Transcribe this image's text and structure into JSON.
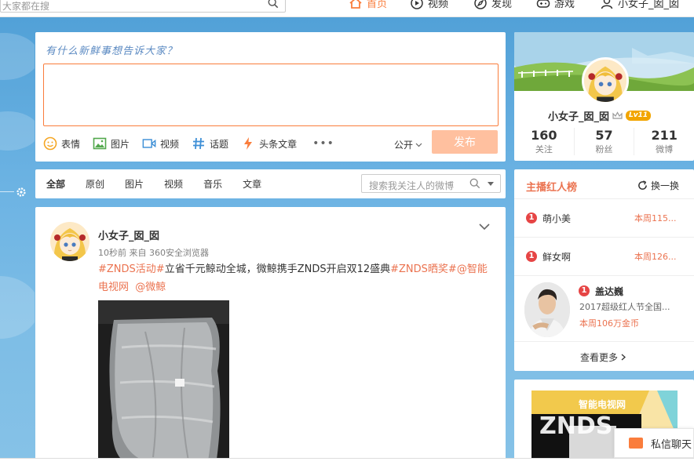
{
  "topbar": {
    "search_placeholder": "大家都在搜",
    "nav": [
      {
        "label": "首页",
        "icon": "home-icon",
        "active": true
      },
      {
        "label": "视频",
        "icon": "video-icon"
      },
      {
        "label": "发现",
        "icon": "discover-icon"
      },
      {
        "label": "游戏",
        "icon": "gamepad-icon"
      },
      {
        "label": "小女子_囡_囡",
        "icon": "user-icon"
      }
    ]
  },
  "publisher": {
    "prompt": "有什么新鲜事想告诉大家？",
    "tools": [
      {
        "label": "表情",
        "icon": "emoji-icon"
      },
      {
        "label": "图片",
        "icon": "image-icon"
      },
      {
        "label": "视频",
        "icon": "video-camera-icon"
      },
      {
        "label": "话题",
        "icon": "hashtag-icon"
      },
      {
        "label": "头条文章",
        "icon": "lightning-icon"
      }
    ],
    "more": "•••",
    "visibility": "公开",
    "publish_label": "发布"
  },
  "feed_tabs": {
    "items": [
      "全部",
      "原创",
      "图片",
      "视频",
      "音乐",
      "文章"
    ],
    "active": "全部",
    "search_placeholder": "搜索我关注人的微博"
  },
  "post": {
    "username": "小女子_囡_囡",
    "meta": "10秒前 来自 360安全浏览器",
    "topic1": "#ZNDS活动#",
    "text1": "立省千元鲸动全城，微鲸携手ZNDS开启双12盛典",
    "topic2": "#ZNDS晒奖#",
    "mention1": "@智能电视网",
    "mention2": "@微鲸"
  },
  "profile": {
    "name": "小女子_囡_囡",
    "level": "Lv11",
    "stats": [
      {
        "value": "160",
        "label": "关注"
      },
      {
        "value": "57",
        "label": "粉丝"
      },
      {
        "value": "211",
        "label": "微博"
      }
    ]
  },
  "rank": {
    "title": "主播红人榜",
    "refresh": "换一换",
    "rows": [
      {
        "num": "1",
        "name": "萌小美",
        "week": "本周115..."
      },
      {
        "num": "1",
        "name": "鲜女啊",
        "week": "本周126..."
      }
    ],
    "featured": {
      "num": "1",
      "name": "盖达巍",
      "desc": "2017超级红人节全国...",
      "week": "本周106万金币"
    },
    "see_more": "查看更多"
  },
  "ad": {
    "text": "ZNDS",
    "subtext": "智能电视网"
  },
  "dm": {
    "label": "私信聊天"
  },
  "colors": {
    "accent": "#fa7d3c",
    "link": "#eb7350",
    "publish_disabled": "#ffc09f",
    "background": "#6cb3e3"
  }
}
